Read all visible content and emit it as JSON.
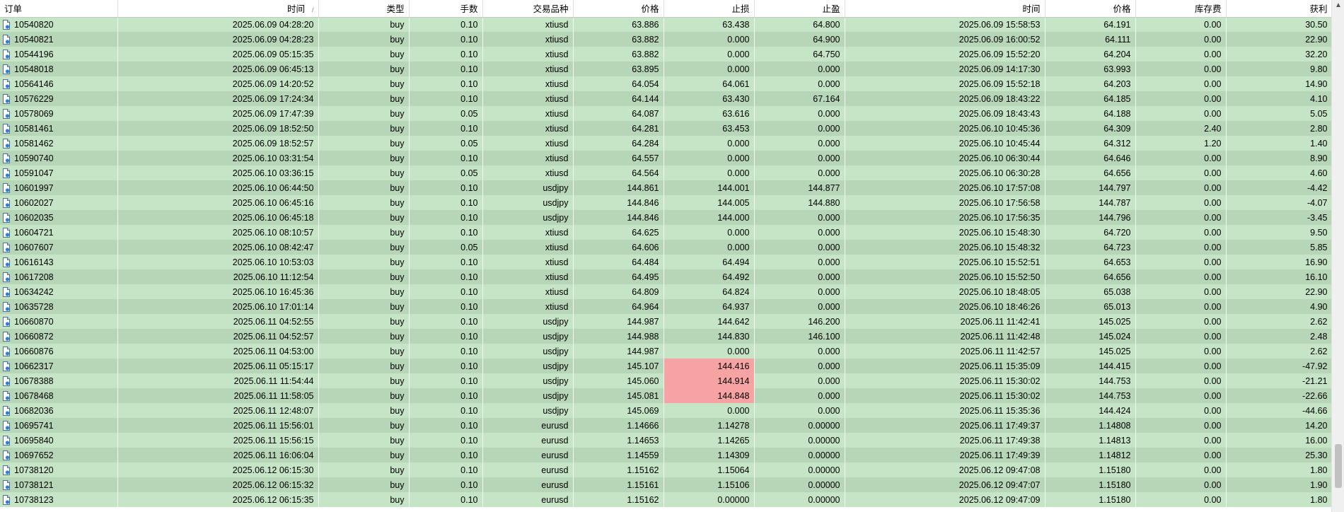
{
  "columns": [
    "订单",
    "时间",
    "类型",
    "手数",
    "交易品种",
    "价格",
    "止损",
    "止盈",
    "时间",
    "价格",
    "库存费",
    "获利"
  ],
  "sort_indicator": "/",
  "rows": [
    [
      "10540820",
      "2025.06.09 04:28:20",
      "buy",
      "0.10",
      "xtiusd",
      "63.886",
      "63.438",
      "64.800",
      "2025.06.09 15:58:53",
      "64.191",
      "0.00",
      "30.50"
    ],
    [
      "10540821",
      "2025.06.09 04:28:23",
      "buy",
      "0.10",
      "xtiusd",
      "63.882",
      "0.000",
      "64.900",
      "2025.06.09 16:00:52",
      "64.111",
      "0.00",
      "22.90"
    ],
    [
      "10544196",
      "2025.06.09 05:15:35",
      "buy",
      "0.10",
      "xtiusd",
      "63.882",
      "0.000",
      "64.750",
      "2025.06.09 15:52:20",
      "64.204",
      "0.00",
      "32.20"
    ],
    [
      "10548018",
      "2025.06.09 06:45:13",
      "buy",
      "0.10",
      "xtiusd",
      "63.895",
      "0.000",
      "0.000",
      "2025.06.09 14:17:30",
      "63.993",
      "0.00",
      "9.80"
    ],
    [
      "10564146",
      "2025.06.09 14:20:52",
      "buy",
      "0.10",
      "xtiusd",
      "64.054",
      "64.061",
      "0.000",
      "2025.06.09 15:52:18",
      "64.203",
      "0.00",
      "14.90"
    ],
    [
      "10576229",
      "2025.06.09 17:24:34",
      "buy",
      "0.10",
      "xtiusd",
      "64.144",
      "63.430",
      "67.164",
      "2025.06.09 18:43:22",
      "64.185",
      "0.00",
      "4.10"
    ],
    [
      "10578069",
      "2025.06.09 17:47:39",
      "buy",
      "0.05",
      "xtiusd",
      "64.087",
      "63.616",
      "0.000",
      "2025.06.09 18:43:43",
      "64.188",
      "0.00",
      "5.05"
    ],
    [
      "10581461",
      "2025.06.09 18:52:50",
      "buy",
      "0.10",
      "xtiusd",
      "64.281",
      "63.453",
      "0.000",
      "2025.06.10 10:45:36",
      "64.309",
      "2.40",
      "2.80"
    ],
    [
      "10581462",
      "2025.06.09 18:52:57",
      "buy",
      "0.05",
      "xtiusd",
      "64.284",
      "0.000",
      "0.000",
      "2025.06.10 10:45:44",
      "64.312",
      "1.20",
      "1.40"
    ],
    [
      "10590740",
      "2025.06.10 03:31:54",
      "buy",
      "0.10",
      "xtiusd",
      "64.557",
      "0.000",
      "0.000",
      "2025.06.10 06:30:44",
      "64.646",
      "0.00",
      "8.90"
    ],
    [
      "10591047",
      "2025.06.10 03:36:15",
      "buy",
      "0.05",
      "xtiusd",
      "64.564",
      "0.000",
      "0.000",
      "2025.06.10 06:30:28",
      "64.656",
      "0.00",
      "4.60"
    ],
    [
      "10601997",
      "2025.06.10 06:44:50",
      "buy",
      "0.10",
      "usdjpy",
      "144.861",
      "144.001",
      "144.877",
      "2025.06.10 17:57:08",
      "144.797",
      "0.00",
      "-4.42"
    ],
    [
      "10602027",
      "2025.06.10 06:45:16",
      "buy",
      "0.10",
      "usdjpy",
      "144.846",
      "144.005",
      "144.880",
      "2025.06.10 17:56:58",
      "144.787",
      "0.00",
      "-4.07"
    ],
    [
      "10602035",
      "2025.06.10 06:45:18",
      "buy",
      "0.10",
      "usdjpy",
      "144.846",
      "144.000",
      "0.000",
      "2025.06.10 17:56:35",
      "144.796",
      "0.00",
      "-3.45"
    ],
    [
      "10604721",
      "2025.06.10 08:10:57",
      "buy",
      "0.10",
      "xtiusd",
      "64.625",
      "0.000",
      "0.000",
      "2025.06.10 15:48:30",
      "64.720",
      "0.00",
      "9.50"
    ],
    [
      "10607607",
      "2025.06.10 08:42:47",
      "buy",
      "0.05",
      "xtiusd",
      "64.606",
      "0.000",
      "0.000",
      "2025.06.10 15:48:32",
      "64.723",
      "0.00",
      "5.85"
    ],
    [
      "10616143",
      "2025.06.10 10:53:03",
      "buy",
      "0.10",
      "xtiusd",
      "64.484",
      "64.494",
      "0.000",
      "2025.06.10 15:52:51",
      "64.653",
      "0.00",
      "16.90"
    ],
    [
      "10617208",
      "2025.06.10 11:12:54",
      "buy",
      "0.10",
      "xtiusd",
      "64.495",
      "64.492",
      "0.000",
      "2025.06.10 15:52:50",
      "64.656",
      "0.00",
      "16.10"
    ],
    [
      "10634242",
      "2025.06.10 16:45:36",
      "buy",
      "0.10",
      "xtiusd",
      "64.809",
      "64.824",
      "0.000",
      "2025.06.10 18:48:05",
      "65.038",
      "0.00",
      "22.90"
    ],
    [
      "10635728",
      "2025.06.10 17:01:14",
      "buy",
      "0.10",
      "xtiusd",
      "64.964",
      "64.937",
      "0.000",
      "2025.06.10 18:46:26",
      "65.013",
      "0.00",
      "4.90"
    ],
    [
      "10660870",
      "2025.06.11 04:52:55",
      "buy",
      "0.10",
      "usdjpy",
      "144.987",
      "144.642",
      "146.200",
      "2025.06.11 11:42:41",
      "145.025",
      "0.00",
      "2.62"
    ],
    [
      "10660872",
      "2025.06.11 04:52:57",
      "buy",
      "0.10",
      "usdjpy",
      "144.988",
      "144.830",
      "146.100",
      "2025.06.11 11:42:48",
      "145.024",
      "0.00",
      "2.48"
    ],
    [
      "10660876",
      "2025.06.11 04:53:00",
      "buy",
      "0.10",
      "usdjpy",
      "144.987",
      "0.000",
      "0.000",
      "2025.06.11 11:42:57",
      "145.025",
      "0.00",
      "2.62"
    ],
    [
      "10662317",
      "2025.06.11 05:15:17",
      "buy",
      "0.10",
      "usdjpy",
      "145.107",
      "144.416",
      "0.000",
      "2025.06.11 15:35:09",
      "144.415",
      "0.00",
      "-47.92"
    ],
    [
      "10678388",
      "2025.06.11 11:54:44",
      "buy",
      "0.10",
      "usdjpy",
      "145.060",
      "144.914",
      "0.000",
      "2025.06.11 15:30:02",
      "144.753",
      "0.00",
      "-21.21"
    ],
    [
      "10678468",
      "2025.06.11 11:58:05",
      "buy",
      "0.10",
      "usdjpy",
      "145.081",
      "144.848",
      "0.000",
      "2025.06.11 15:30:02",
      "144.753",
      "0.00",
      "-22.66"
    ],
    [
      "10682036",
      "2025.06.11 12:48:07",
      "buy",
      "0.10",
      "usdjpy",
      "145.069",
      "0.000",
      "0.000",
      "2025.06.11 15:35:36",
      "144.424",
      "0.00",
      "-44.66"
    ],
    [
      "10695741",
      "2025.06.11 15:56:01",
      "buy",
      "0.10",
      "eurusd",
      "1.14666",
      "1.14278",
      "0.00000",
      "2025.06.11 17:49:37",
      "1.14808",
      "0.00",
      "14.20"
    ],
    [
      "10695840",
      "2025.06.11 15:56:15",
      "buy",
      "0.10",
      "eurusd",
      "1.14653",
      "1.14265",
      "0.00000",
      "2025.06.11 17:49:38",
      "1.14813",
      "0.00",
      "16.00"
    ],
    [
      "10697652",
      "2025.06.11 16:06:04",
      "buy",
      "0.10",
      "eurusd",
      "1.14559",
      "1.14309",
      "0.00000",
      "2025.06.11 17:49:39",
      "1.14812",
      "0.00",
      "25.30"
    ],
    [
      "10738120",
      "2025.06.12 06:15:30",
      "buy",
      "0.10",
      "eurusd",
      "1.15162",
      "1.15064",
      "0.00000",
      "2025.06.12 09:47:08",
      "1.15180",
      "0.00",
      "1.80"
    ],
    [
      "10738121",
      "2025.06.12 06:15:32",
      "buy",
      "0.10",
      "eurusd",
      "1.15161",
      "1.15106",
      "0.00000",
      "2025.06.12 09:47:07",
      "1.15180",
      "0.00",
      "1.90"
    ],
    [
      "10738123",
      "2025.06.12 06:15:35",
      "buy",
      "0.10",
      "eurusd",
      "1.15162",
      "0.00000",
      "0.00000",
      "2025.06.12 09:47:09",
      "1.15180",
      "0.00",
      "1.80"
    ]
  ],
  "highlighted_stoploss_rows": [
    23,
    24,
    25
  ],
  "colors": {
    "row_odd": "#c6e4c6",
    "row_even": "#b7d5b7",
    "stoploss_highlight": "#f7a3a3",
    "header_bg": "#ffffff"
  },
  "icons": {
    "row_icon": "order-document-icon",
    "scroll_up": "chevron-up-icon"
  }
}
